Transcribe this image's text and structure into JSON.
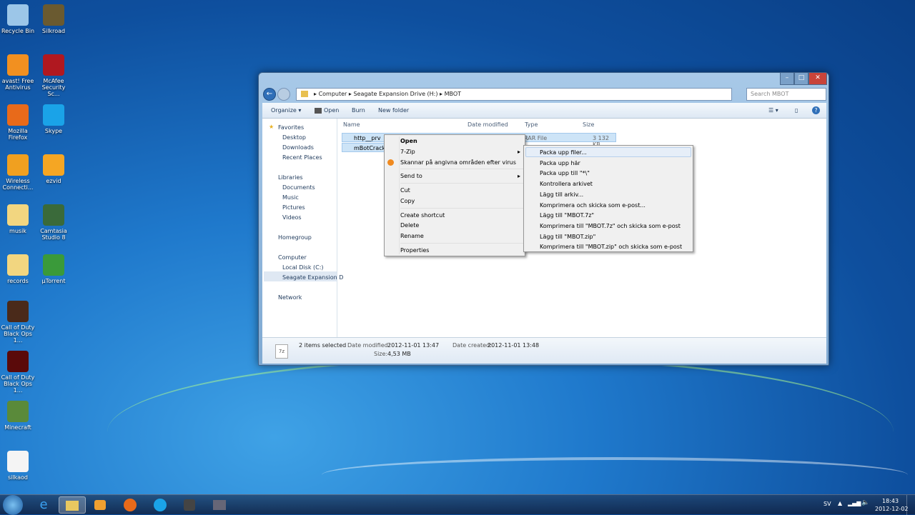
{
  "desktop": {
    "icons": [
      {
        "label": "Recycle Bin",
        "color": "#9cc6e8"
      },
      {
        "label": "Silkroad",
        "color": "#6a5a30"
      },
      {
        "label": "avast! Free Antivirus",
        "color": "#f29020"
      },
      {
        "label": "McAfee Security Sc...",
        "color": "#b01820"
      },
      {
        "label": "Mozilla Firefox",
        "color": "#e86a1a"
      },
      {
        "label": "Skype",
        "color": "#1aa3e8"
      },
      {
        "label": "Wireless Connecti...",
        "color": "#f0a020"
      },
      {
        "label": "ezvid",
        "color": "#f5a623"
      },
      {
        "label": "musik",
        "color": "#f2d680"
      },
      {
        "label": "Camtasia Studio 8",
        "color": "#3a6a3a"
      },
      {
        "label": "records",
        "color": "#f2d680"
      },
      {
        "label": "µTorrent",
        "color": "#3a9a3a"
      },
      {
        "label": "Call of Duty Black Ops 1...",
        "color": "#4a2a1a"
      },
      {
        "label": "Call of Duty Black Ops 1...",
        "color": "#5a0a0a"
      },
      {
        "label": "Minecraft",
        "color": "#5a8a3a"
      },
      {
        "label": "silkaod",
        "color": "#f4f4f4"
      }
    ]
  },
  "window": {
    "breadcrumb": [
      "Computer",
      "Seagate Expansion Drive (H:)",
      "MBOT"
    ],
    "search_placeholder": "Search MBOT",
    "toolbar": {
      "organize": "Organize ▾",
      "open": "Open",
      "burn": "Burn",
      "new_folder": "New folder"
    },
    "nav": {
      "favorites": "Favorites",
      "desktop": "Desktop",
      "downloads": "Downloads",
      "recent": "Recent Places",
      "libraries": "Libraries",
      "documents": "Documents",
      "music": "Music",
      "pictures": "Pictures",
      "videos": "Videos",
      "homegroup": "Homegroup",
      "computer": "Computer",
      "local_disk": "Local Disk (C:)",
      "seagate": "Seagate Expansion D",
      "network": "Network"
    },
    "columns": {
      "name": "Name",
      "date": "Date modified",
      "type": "Type",
      "size": "Size"
    },
    "files": [
      {
        "name": "http__prv",
        "type": "RAR File",
        "size": "3 132 KB"
      },
      {
        "name": "mBotCrack",
        "type": "",
        "size": ""
      }
    ],
    "status": {
      "count": "2 items selected",
      "date_modified_label": "Date modified:",
      "date_modified": "2012-11-01 13:47",
      "date_created_label": "Date created:",
      "date_created": "2012-11-01 13:48",
      "size_label": "Size:",
      "size": "4,53 MB"
    }
  },
  "context_menu": [
    "Open",
    "7-Zip",
    "Skannar på angivna områden efter virus",
    "Send to",
    "Cut",
    "Copy",
    "Create shortcut",
    "Delete",
    "Rename",
    "Properties"
  ],
  "submenu": [
    "Packa upp filer...",
    "Packa upp här",
    "Packa upp till \"*\\\"",
    "Kontrollera arkivet",
    "Lägg till arkiv...",
    "Komprimera och skicka som e-post...",
    "Lägg till \"MBOT.7z\"",
    "Komprimera till \"MBOT.7z\" och skicka som e-post",
    "Lägg till \"MBOT.zip\"",
    "Komprimera till \"MBOT.zip\" och skicka som e-post"
  ],
  "tray": {
    "lang": "SV",
    "time": "18:43",
    "date": "2012-12-02"
  }
}
